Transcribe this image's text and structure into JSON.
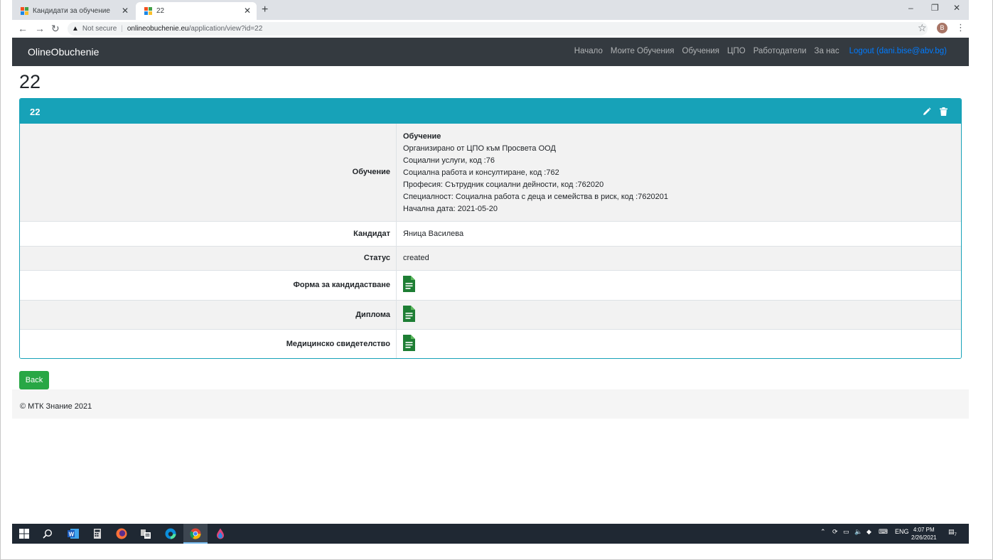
{
  "browser": {
    "tabs": [
      {
        "title": "Кандидати за обучение"
      },
      {
        "title": "22"
      }
    ],
    "address": {
      "security": "Not secure",
      "host": "onlineobuchenie.eu",
      "path": "/application/view?id=22"
    },
    "profile_initial": "B"
  },
  "navbar": {
    "brand": "OlineObuchenie",
    "links": [
      "Начало",
      "Моите Обучения",
      "Обучения",
      "ЦПО",
      "Работодатели",
      "За нас"
    ],
    "logout": "Logout (dani.bise@abv.bg)"
  },
  "page": {
    "heading": "22",
    "card_title": "22"
  },
  "details": {
    "training": {
      "label": "Обучение",
      "title": "Обучение",
      "lines": [
        "Организирано от ЦПО към Просвета ООД",
        "Социални услуги, код :76",
        "Социална работа и консултиране, код :762",
        "Професия: Сътрудник социални дейности, код :762020",
        "Специалност: Социална работа с деца и семейства в риск, код :7620201",
        "Начална дата: 2021-05-20"
      ]
    },
    "candidate": {
      "label": "Кандидат",
      "value": "Яница Василева"
    },
    "status": {
      "label": "Статус",
      "value": "created"
    },
    "application_form": {
      "label": "Форма за кандидастване"
    },
    "diploma": {
      "label": "Диплома"
    },
    "medical": {
      "label": "Медицинско свидетелство"
    }
  },
  "actions": {
    "back": "Back"
  },
  "footer": {
    "text": "© МТК Знание 2021"
  },
  "taskbar": {
    "lang": "ENG",
    "time": "4:07 PM",
    "date": "2/26/2021",
    "notification_count": "7"
  },
  "colors": {
    "navbar": "#343a40",
    "card_header": "#17a2b8",
    "back_button": "#28a745",
    "file_icon": "#1e7e34",
    "link": "#007bff"
  }
}
